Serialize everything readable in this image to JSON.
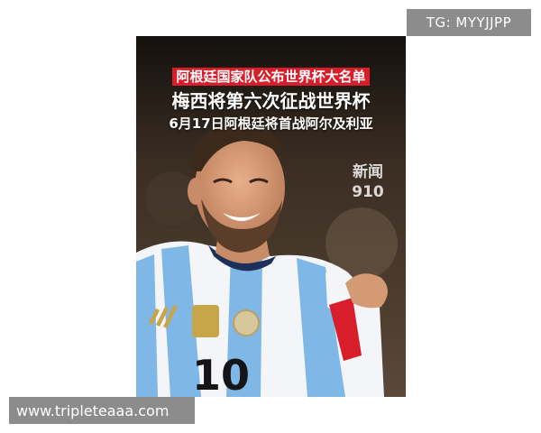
{
  "watermark_top": "TG: MYYJJPP",
  "watermark_bottom": "www.tripleteaaa.com",
  "poster": {
    "line1": "阿根廷国家队公布世界杯大名单",
    "line2": "梅西将第六次征战世界杯",
    "line3": "6月17日阿根廷将首战阿尔及利亚",
    "logo_line1": "新闻",
    "logo_line2": "910",
    "jersey_number": "10"
  },
  "colors": {
    "background": "#ffffff",
    "badge": "#8c8c8c",
    "highlight_red": "#d81e2a",
    "jersey_blue": "#7fb8e6"
  }
}
